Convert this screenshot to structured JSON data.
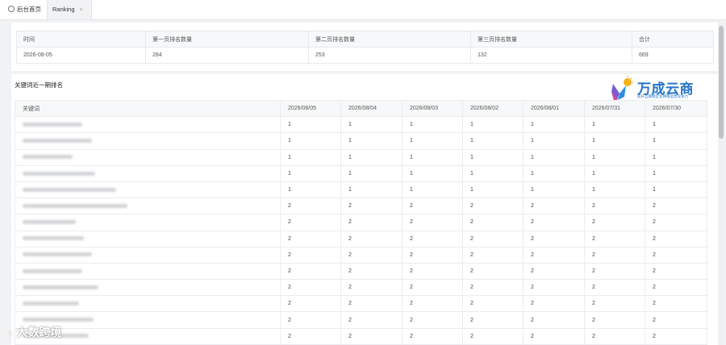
{
  "tabs": {
    "home": "后台首页",
    "active": "Ranking",
    "close": "×"
  },
  "summary": {
    "headers": [
      "时间",
      "第一页排名数量",
      "第二页排名数量",
      "第三页排名数量",
      "合计"
    ],
    "values": [
      "2026-08-05",
      "284",
      "253",
      "132",
      "669"
    ]
  },
  "section_title": "关键词近一期排名",
  "logo": {
    "name": "万成云商",
    "tagline": "提升互联网企业网络运营竞争力"
  },
  "keywords": {
    "headers": [
      "关键词",
      "2026/08/05",
      "2026/08/04",
      "2026/08/03",
      "2026/08/02",
      "2026/08/01",
      "2026/07/31",
      "2026/07/30"
    ],
    "rows": [
      [
        "1",
        "1",
        "1",
        "1",
        "1",
        "1",
        "1"
      ],
      [
        "1",
        "1",
        "1",
        "1",
        "1",
        "1",
        "1"
      ],
      [
        "1",
        "1",
        "1",
        "1",
        "1",
        "1",
        "1"
      ],
      [
        "1",
        "1",
        "1",
        "1",
        "1",
        "1",
        "1"
      ],
      [
        "1",
        "1",
        "1",
        "1",
        "1",
        "1",
        "1"
      ],
      [
        "2",
        "2",
        "2",
        "2",
        "2",
        "2",
        "2"
      ],
      [
        "2",
        "2",
        "2",
        "2",
        "2",
        "2",
        "2"
      ],
      [
        "2",
        "2",
        "2",
        "2",
        "2",
        "2",
        "2"
      ],
      [
        "2",
        "2",
        "2",
        "2",
        "2",
        "2",
        "2"
      ],
      [
        "2",
        "2",
        "2",
        "2",
        "2",
        "2",
        "2"
      ],
      [
        "2",
        "2",
        "2",
        "2",
        "2",
        "2",
        "2"
      ],
      [
        "2",
        "2",
        "2",
        "2",
        "2",
        "2",
        "2"
      ],
      [
        "2",
        "2",
        "2",
        "2",
        "2",
        "2",
        "2"
      ],
      [
        "2",
        "2",
        "2",
        "2",
        "2",
        "2",
        "2"
      ]
    ]
  },
  "watermark": "大数跨境"
}
